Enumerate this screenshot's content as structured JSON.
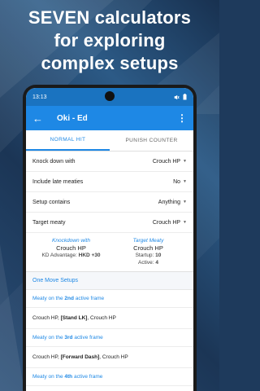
{
  "headline": {
    "line1": "SEVEN calculators",
    "line2": "for exploring",
    "line3": "complex setups"
  },
  "status_bar": {
    "time": "13:13"
  },
  "app_bar": {
    "title": "Oki - Ed",
    "back_icon": "arrow-back-icon",
    "more_icon": "more-vert-icon"
  },
  "tabs": [
    {
      "label": "NORMAL HIT",
      "active": true
    },
    {
      "label": "PUNISH COUNTER",
      "active": false
    }
  ],
  "settings": [
    {
      "label": "Knock down with",
      "value": "Crouch HP"
    },
    {
      "label": "Include late meaties",
      "value": "No"
    },
    {
      "label": "Setup contains",
      "value": "Anything"
    },
    {
      "label": "Target meaty",
      "value": "Crouch HP"
    }
  ],
  "summary": {
    "knockdown": {
      "heading": "Knockdown with",
      "move": "Crouch HP",
      "kd_label": "KD Advantage:",
      "kd_value": "HKD +30"
    },
    "target": {
      "heading": "Target Meaty",
      "move": "Crouch HP",
      "startup_label": "Startup:",
      "startup_value": "10",
      "active_label": "Active:",
      "active_value": "4"
    }
  },
  "section": {
    "title": "One Move Setups"
  },
  "results": [
    {
      "meaty_prefix": "Meaty on the",
      "frame": "2nd",
      "meaty_suffix": "active frame",
      "seq_a": "Crouch HP,",
      "seq_b": "[Stand LK]",
      "seq_c": ", Crouch HP"
    },
    {
      "meaty_prefix": "Meaty on the",
      "frame": "3rd",
      "meaty_suffix": "active frame",
      "seq_a": "Crouch HP,",
      "seq_b": "[Forward Dash]",
      "seq_c": ", Crouch HP"
    },
    {
      "meaty_prefix": "Meaty on the",
      "frame": "4th",
      "meaty_suffix": "active frame"
    }
  ],
  "colors": {
    "primary": "#1e88e5",
    "status": "#1a73c0",
    "background": "#1e3a5c"
  }
}
